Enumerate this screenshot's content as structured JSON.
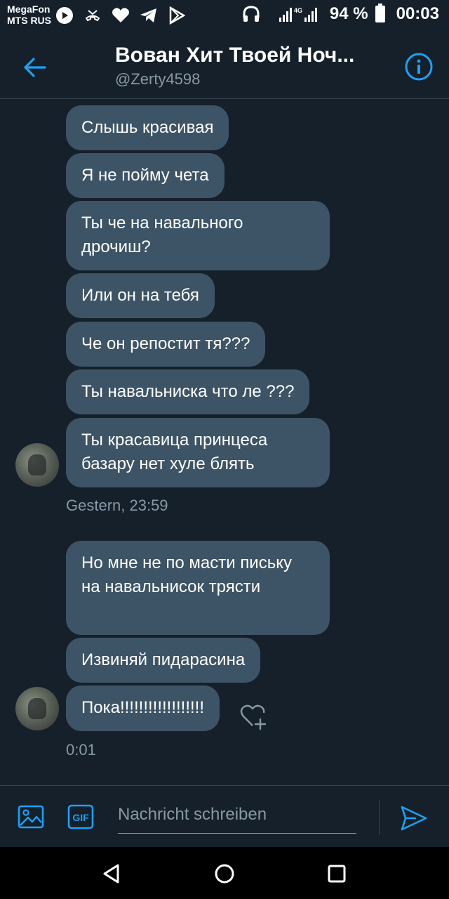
{
  "status_bar": {
    "carrier_1": "MegaFon",
    "carrier_2": "MTS RUS",
    "battery": "94 %",
    "time": "00:03",
    "network_label": "4G"
  },
  "header": {
    "title": "Вован Хит Твоей Ноч...",
    "handle": "@Zerty4598"
  },
  "messages": [
    {
      "text": "Слышь красивая"
    },
    {
      "text": "Я не пойму чета"
    },
    {
      "text": "Ты че на навального дрочиш?"
    },
    {
      "text": "Или он на тебя"
    },
    {
      "text": "Че он репостит тя???"
    },
    {
      "text": "Ты навальниска что ле ???"
    },
    {
      "text": "Ты красавица принцеса базару нет хуле блять"
    },
    {
      "text": "Но мне не по масти письку на навальнисок трясти"
    },
    {
      "text": "Извиняй пидарасина"
    },
    {
      "text": "Пока!!!!!!!!!!!!!!!!!!"
    }
  ],
  "timestamps": [
    "Gestern, 23:59",
    "0:01"
  ],
  "composer": {
    "placeholder": "Nachricht schreiben",
    "gif_label": "GIF"
  },
  "colors": {
    "background": "#15202b",
    "bubble": "#3d5466",
    "accent": "#1da1f2",
    "muted": "#8899a6"
  }
}
